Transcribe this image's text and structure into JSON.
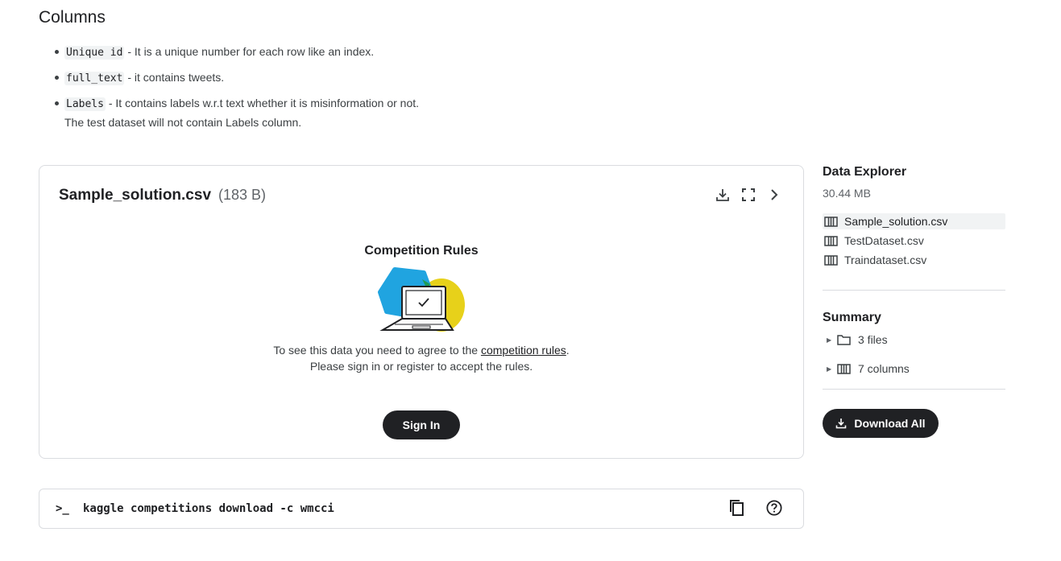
{
  "columns_section": {
    "title": "Columns",
    "items": [
      {
        "code": "Unique id",
        "text": " - It is a unique number for each row like an index."
      },
      {
        "code": "full_text",
        "text": " - it contains tweets."
      },
      {
        "code": "Labels",
        "text": " - It contains labels w.r.t text whether it is misinformation or not.",
        "extra": "The test dataset will not contain Labels column."
      }
    ]
  },
  "file_preview": {
    "file_name": "Sample_solution.csv",
    "file_size": "(183 B)",
    "icons": [
      "download-icon",
      "fullscreen-icon",
      "chevron-right-icon"
    ],
    "rules_title": "Competition Rules",
    "rules_text_before": "To see this data you need to agree to the ",
    "rules_link": "competition rules",
    "rules_text_after": ".",
    "rules_text_line2": "Please sign in or register to accept the rules.",
    "sign_in_label": "Sign In"
  },
  "cli": {
    "prompt": ">_",
    "command": "kaggle competitions download -c wmcci",
    "icons": [
      "copy-icon",
      "help-icon"
    ]
  },
  "data_explorer": {
    "title": "Data Explorer",
    "size": "30.44 MB",
    "files": [
      {
        "name": "Sample_solution.csv",
        "selected": true
      },
      {
        "name": "TestDataset.csv",
        "selected": false
      },
      {
        "name": "Traindataset.csv",
        "selected": false
      }
    ],
    "summary_title": "Summary",
    "summary_files": "3 files",
    "summary_columns": "7 columns",
    "download_all_label": "Download All"
  },
  "colors": {
    "text": "#202124",
    "muted": "#5f6368",
    "border": "#dadce0",
    "button_bg": "#202124",
    "illus_blue": "#20a4e0",
    "illus_yellow": "#e7d11a",
    "illus_green": "#1e9b57"
  }
}
